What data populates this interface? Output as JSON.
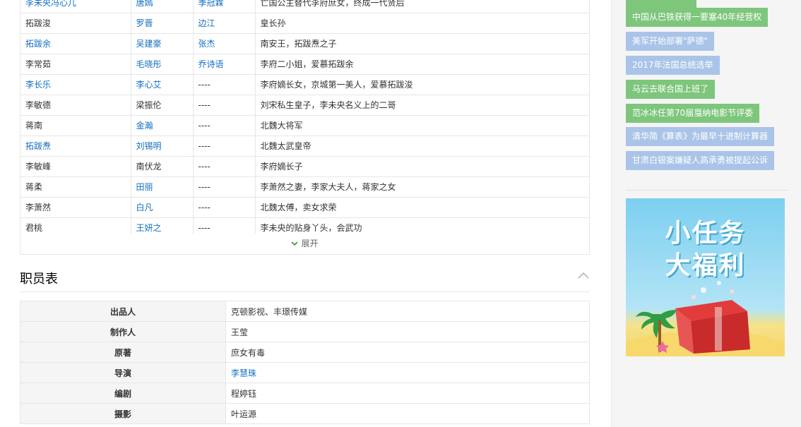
{
  "cast": {
    "rows": [
      {
        "role": "李未央冯心儿",
        "role_link": true,
        "actor": "唐嫣",
        "actor_link": true,
        "dubber": "季冠霖",
        "dubber_link": true,
        "desc": "亡国公主替代李府庶女，终成一代贤后"
      },
      {
        "role": "拓跋浚",
        "role_link": false,
        "actor": "罗晋",
        "actor_link": true,
        "dubber": "边江",
        "dubber_link": true,
        "desc": "皇长孙"
      },
      {
        "role": "拓跋余",
        "role_link": true,
        "actor": "吴建豪",
        "actor_link": true,
        "dubber": "张杰",
        "dubber_link": true,
        "desc": "南安王，拓跋焘之子"
      },
      {
        "role": "李常茹",
        "role_link": false,
        "actor": "毛晓彤",
        "actor_link": true,
        "dubber": "乔诗语",
        "dubber_link": true,
        "desc": "李府二小姐，爱慕拓跋余"
      },
      {
        "role": "李长乐",
        "role_link": true,
        "actor": "李心艾",
        "actor_link": true,
        "dubber": "----",
        "dubber_link": false,
        "desc": "李府嫡长女，京城第一美人，爱慕拓跋浚"
      },
      {
        "role": "李敏德",
        "role_link": false,
        "actor": "梁振伦",
        "actor_link": false,
        "dubber": "----",
        "dubber_link": false,
        "desc": "刘宋私生皇子，李未央名义上的二哥"
      },
      {
        "role": "蒋南",
        "role_link": false,
        "actor": "金瀚",
        "actor_link": true,
        "dubber": "----",
        "dubber_link": false,
        "desc": "北魏大将军"
      },
      {
        "role": "拓跋焘",
        "role_link": true,
        "actor": "刘锡明",
        "actor_link": true,
        "dubber": "----",
        "dubber_link": false,
        "desc": "北魏太武皇帝"
      },
      {
        "role": "李敏峰",
        "role_link": false,
        "actor": "南伏龙",
        "actor_link": false,
        "dubber": "----",
        "dubber_link": false,
        "desc": "李府嫡长子"
      },
      {
        "role": "蒋柔",
        "role_link": false,
        "actor": "田丽",
        "actor_link": true,
        "dubber": "----",
        "dubber_link": false,
        "desc": "李萧然之妻，李家大夫人，蒋家之女"
      },
      {
        "role": "李萧然",
        "role_link": false,
        "actor": "白凡",
        "actor_link": true,
        "dubber": "----",
        "dubber_link": false,
        "desc": "北魏太傅，卖女求荣"
      },
      {
        "role": "君桃",
        "role_link": false,
        "actor": "王妍之",
        "actor_link": true,
        "dubber": "----",
        "dubber_link": false,
        "desc": "李未央的贴身丫头，会武功"
      }
    ],
    "expand_label": "展开"
  },
  "staff": {
    "title": "职员表",
    "rows": [
      {
        "key": "出品人",
        "value": "克顿影视、丰璟传媒",
        "link": false
      },
      {
        "key": "制作人",
        "value": "王莹",
        "link": false
      },
      {
        "key": "原著",
        "value": "庶女有毒",
        "link": false
      },
      {
        "key": "导演",
        "value": "李慧珠",
        "link": true
      },
      {
        "key": "编剧",
        "value": "程婷钰",
        "link": false
      },
      {
        "key": "摄影",
        "value": "叶运源",
        "link": false
      }
    ]
  },
  "sidebar": {
    "tags": [
      {
        "label": "",
        "color": "#7dc67c"
      },
      {
        "label": "中国从巴铁获得一要塞40年经营权",
        "color": "#7dc67c"
      },
      {
        "label": "美军开始部署\"萨德\"",
        "color": "#a9c4e8"
      },
      {
        "label": "2017年法国总统选举",
        "color": "#a9c4e8"
      },
      {
        "label": "马云去联合国上班了",
        "color": "#7dc67c"
      },
      {
        "label": "范冰冰任第70届戛纳电影节评委",
        "color": "#7dc67c"
      },
      {
        "label": "清华简《算表》为最早十进制计算器",
        "color": "#a9c4e8"
      },
      {
        "label": "甘肃白银案嫌疑人高承勇被提起公诉",
        "color": "#a9c4e8"
      }
    ],
    "ad": {
      "line1": "小任务",
      "line2": "大福利"
    }
  }
}
